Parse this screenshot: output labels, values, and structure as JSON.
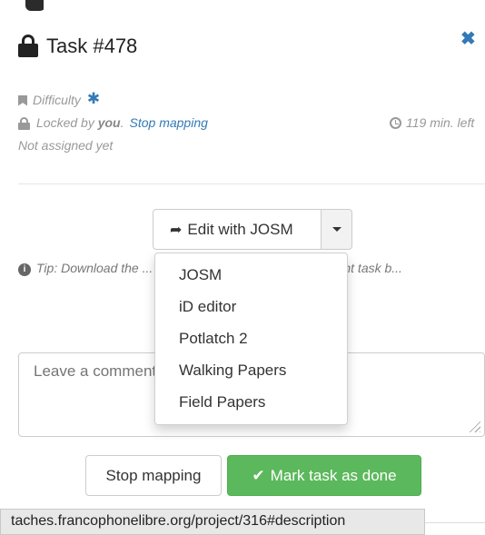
{
  "task": {
    "title": "Task #478",
    "difficulty_label": "Difficulty",
    "locked_by_prefix": "Locked by",
    "locked_by_user": "you",
    "locked_by_suffix": ".",
    "stop_mapping_link": "Stop mapping",
    "time_left": "119 min. left",
    "assignment": "Not assigned yet"
  },
  "editor": {
    "button_label": "Edit with JOSM",
    "options": [
      "JOSM",
      "iD editor",
      "Potlatch 2",
      "Walking Papers",
      "Field Papers"
    ]
  },
  "tip": {
    "text": "Tip: Download the ... in JOSM in order to see the current task b..."
  },
  "comment": {
    "placeholder": "Leave a comment"
  },
  "actions": {
    "stop_mapping": "Stop mapping",
    "mark_done": "Mark task as done"
  },
  "status_bar": {
    "url": "taches.francophonelibre.org/project/316#description"
  },
  "colors": {
    "link": "#337ab7",
    "success": "#5cb85c"
  }
}
